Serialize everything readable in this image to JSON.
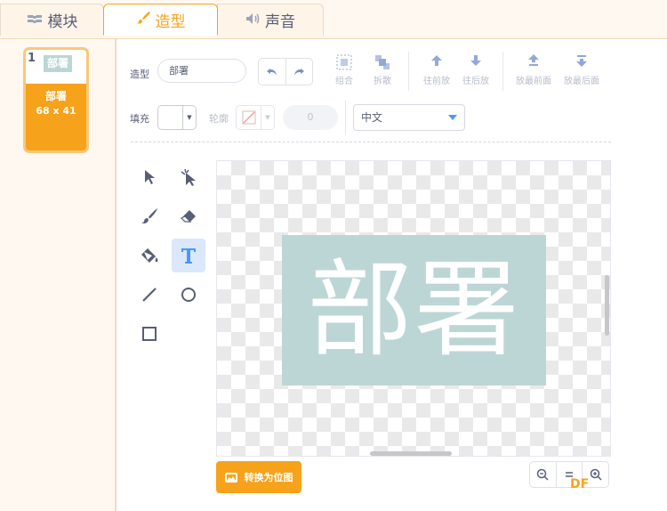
{
  "tabs": [
    {
      "label": "模块",
      "icon": "code-blocks-icon"
    },
    {
      "label": "造型",
      "icon": "paintbrush-icon",
      "active": true
    },
    {
      "label": "声音",
      "icon": "speaker-icon"
    }
  ],
  "costume": {
    "number": "1",
    "thumb_text": "部署",
    "name": "部署",
    "size": "68 x 41"
  },
  "toolbar": {
    "costume_label": "造型",
    "costume_name": "部署",
    "group_label": "组合",
    "ungroup_label": "拆散",
    "forward_label": "往前放",
    "backward_label": "往后放",
    "front_label": "放最前面",
    "back_label": "放最后面",
    "fill_label": "填充",
    "outline_label": "轮廓",
    "outline_width": "0",
    "font": "中文"
  },
  "canvas": {
    "text": "部署",
    "text_bg_color": "#bcd6d6"
  },
  "bottom": {
    "convert_label": "转换为位图",
    "watermark": "DF"
  },
  "colors": {
    "accent": "#f7a21b",
    "blue": "#4c97ff"
  }
}
